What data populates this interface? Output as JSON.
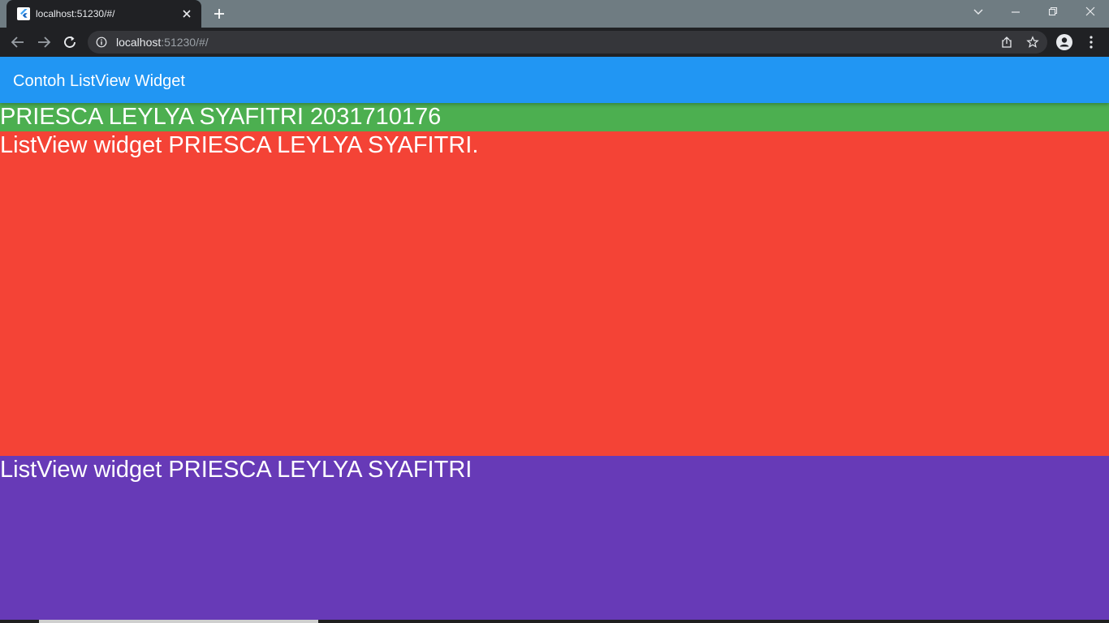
{
  "browser": {
    "tab": {
      "title": "localhost:51230/#/"
    },
    "address": {
      "host": "localhost",
      "rest": ":51230/#/"
    }
  },
  "app": {
    "appbar_title": "Contoh ListView Widget",
    "items": [
      {
        "text": "PRIESCA LEYLYA SYAFITRI 2031710176",
        "color": "#4caf50"
      },
      {
        "text": "ListView widget PRIESCA LEYLYA SYAFITRI.",
        "color": "#f44336"
      },
      {
        "text": "ListView widget PRIESCA LEYLYA SYAFITRI",
        "color": "#673ab7"
      }
    ]
  },
  "colors": {
    "appbar": "#2196f3",
    "tabstrip": "#6f7c82",
    "toolbar": "#202124"
  }
}
